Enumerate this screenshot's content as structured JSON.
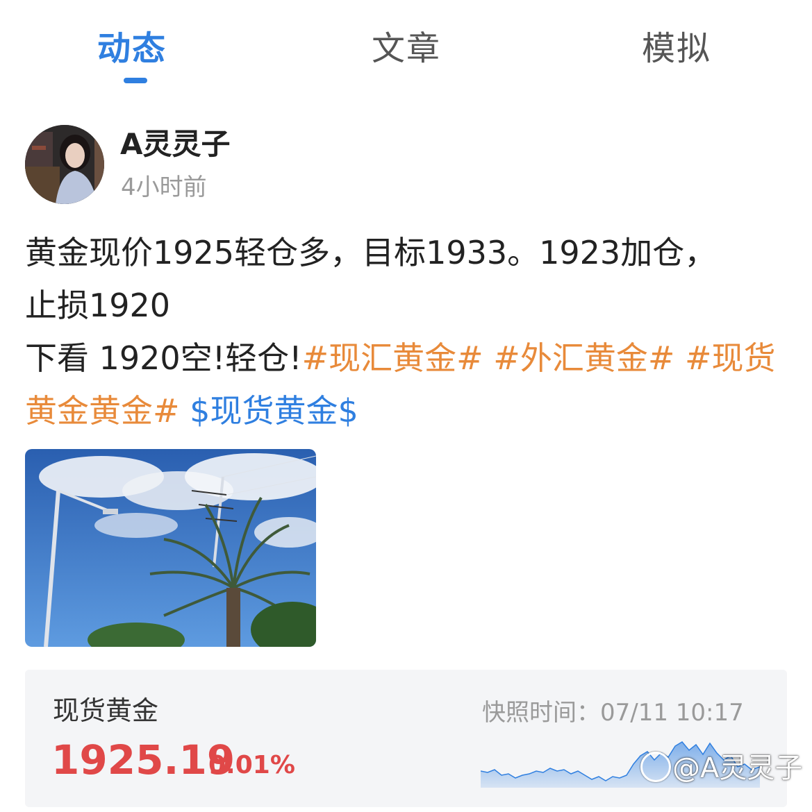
{
  "tabs": [
    {
      "label": "动态",
      "active": true
    },
    {
      "label": "文章",
      "active": false
    },
    {
      "label": "模拟",
      "active": false
    }
  ],
  "post": {
    "username": "A灵灵子",
    "time": "4小时前",
    "line1": "黄金现价1925轻仓多，目标1933。1923加仓，止损1920",
    "line2": "下看 1920空!轻仓!",
    "hashtags": [
      "#现汇黄金#",
      "#外汇黄金#",
      "#现货黄金黄金#"
    ],
    "stock_tag": "$现货黄金$"
  },
  "quote": {
    "name": "现货黄金",
    "price": "1925.19",
    "change": "0.01%",
    "snapshot": "快照时间：07/11 10:17"
  },
  "watermark": "@A灵灵子",
  "colors": {
    "accent": "#2f7fe0",
    "hashtag": "#e88a3a",
    "price_up": "#e04848"
  },
  "icons": {
    "avatar": "avatar-photo",
    "photo": "palm-tree-sky-photo",
    "watermark": "app-logo-icon"
  }
}
